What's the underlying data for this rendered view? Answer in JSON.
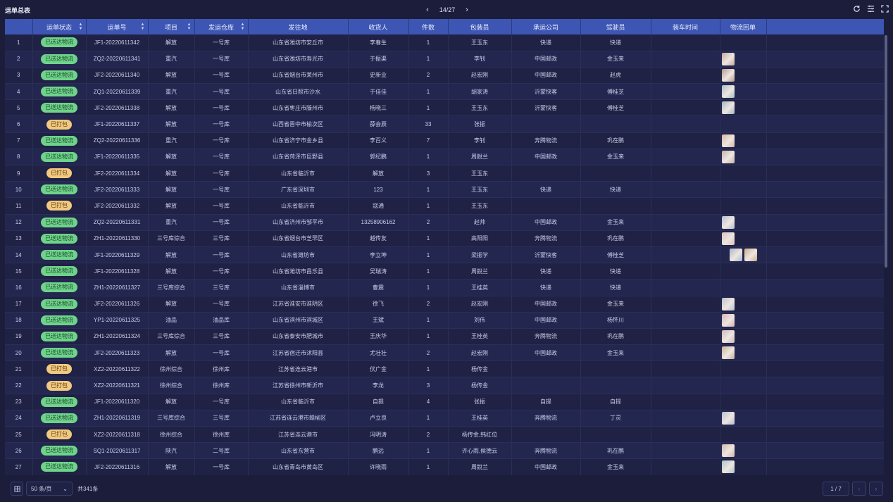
{
  "header": {
    "title": "运单总表",
    "page_indicator": "14/27",
    "prev_icon": "chevron-left-icon",
    "next_icon": "chevron-right-icon",
    "tools": [
      "refresh-icon",
      "column-settings-icon",
      "fullscreen-icon"
    ]
  },
  "table": {
    "columns": [
      "",
      "运单状态",
      "运单号",
      "项目",
      "发运仓库",
      "发往地",
      "收货人",
      "件数",
      "包装员",
      "承运公司",
      "驾驶员",
      "装车时间",
      "物流回单"
    ],
    "rows": [
      {
        "no": "1",
        "status": "已送达物流",
        "waybill": "JF1-20220611342",
        "project": "解放",
        "warehouse": "一号库",
        "dest": "山东省潍坊市安丘市",
        "consignee": "李春生",
        "qty": "1",
        "packer": "王玉东",
        "carrier": "快递",
        "driver": "快递",
        "time": "",
        "receipt": []
      },
      {
        "no": "2",
        "status": "已送达物流",
        "waybill": "ZQ2-20220611341",
        "project": "重汽",
        "warehouse": "一号库",
        "dest": "山东省潍坊市寿光市",
        "consignee": "于振渠",
        "qty": "1",
        "packer": "李钊",
        "carrier": "中国邮政",
        "driver": "金玉来",
        "time": "",
        "receipt": [
          "#c9a79a"
        ]
      },
      {
        "no": "3",
        "status": "已送达物流",
        "waybill": "JF2-20220611340",
        "project": "解放",
        "warehouse": "一号库",
        "dest": "山东省烟台市莱州市",
        "consignee": "史新业",
        "qty": "2",
        "packer": "赵宏刚",
        "carrier": "中国邮政",
        "driver": "赵虎",
        "time": "",
        "receipt": [
          "#b8998f"
        ]
      },
      {
        "no": "4",
        "status": "已送达物流",
        "waybill": "ZQ1-20220611339",
        "project": "重汽",
        "warehouse": "一号库",
        "dest": "山东省日照市沙水",
        "consignee": "于佳佳",
        "qty": "1",
        "packer": "胡家涛",
        "carrier": "沂蒙快客",
        "driver": "傅桂芝",
        "time": "",
        "receipt": [
          "#a9c0c6"
        ]
      },
      {
        "no": "5",
        "status": "已送达物流",
        "waybill": "JF2-20220611338",
        "project": "解放",
        "warehouse": "一号库",
        "dest": "山东省枣庄市滕州市",
        "consignee": "杨晓三",
        "qty": "1",
        "packer": "王玉东",
        "carrier": "沂蒙快客",
        "driver": "傅桂芝",
        "time": "",
        "receipt": [
          "#9fb7c4"
        ]
      },
      {
        "no": "6",
        "status": "已打包",
        "waybill": "JF1-20220611337",
        "project": "解放",
        "warehouse": "一号库",
        "dest": "山西省晋中市榆次区",
        "consignee": "薛会辰",
        "qty": "33",
        "packer": "张振",
        "carrier": "",
        "driver": "",
        "time": "",
        "receipt": []
      },
      {
        "no": "7",
        "status": "已送达物流",
        "waybill": "ZQ2-20220611336",
        "project": "重汽",
        "warehouse": "一号库",
        "dest": "山东省济宁市金乡县",
        "consignee": "李百义",
        "qty": "7",
        "packer": "李钊",
        "carrier": "奔腾物流",
        "driver": "巩在鹏",
        "time": "",
        "receipt": [
          "#d8b4a8"
        ]
      },
      {
        "no": "8",
        "status": "已送达物流",
        "waybill": "JF1-20220611335",
        "project": "解放",
        "warehouse": "一号库",
        "dest": "山东省菏泽市巨野县",
        "consignee": "郭纪鹏",
        "qty": "1",
        "packer": "周銳兰",
        "carrier": "中国邮政",
        "driver": "金玉来",
        "time": "",
        "receipt": [
          "#c4b4a8"
        ]
      },
      {
        "no": "9",
        "status": "已打包",
        "waybill": "JF2-20220611334",
        "project": "解放",
        "warehouse": "一号库",
        "dest": "山东省临沂市",
        "consignee": "解放",
        "qty": "3",
        "packer": "王玉东",
        "carrier": "",
        "driver": "",
        "time": "",
        "receipt": []
      },
      {
        "no": "10",
        "status": "已送达物流",
        "waybill": "JF2-20220611333",
        "project": "解放",
        "warehouse": "一号库",
        "dest": "广东省深圳市",
        "consignee": "123",
        "qty": "1",
        "packer": "王玉东",
        "carrier": "快递",
        "driver": "快递",
        "time": "",
        "receipt": []
      },
      {
        "no": "11",
        "status": "已打包",
        "waybill": "JF2-20220611332",
        "project": "解放",
        "warehouse": "一号库",
        "dest": "山东省临沂市",
        "consignee": "寇通",
        "qty": "1",
        "packer": "王玉东",
        "carrier": "",
        "driver": "",
        "time": "",
        "receipt": []
      },
      {
        "no": "12",
        "status": "已送达物流",
        "waybill": "ZQ2-20220611331",
        "project": "重汽",
        "warehouse": "一号库",
        "dest": "山东省济州市邹平市",
        "consignee": "13258906162",
        "qty": "2",
        "packer": "赵帅",
        "carrier": "中国邮政",
        "driver": "金玉来",
        "time": "",
        "receipt": [
          "#b3c2d3"
        ]
      },
      {
        "no": "13",
        "status": "已送达物流",
        "waybill": "ZH1-20220611330",
        "project": "三号库综合",
        "warehouse": "三号库",
        "dest": "山东省烟台市芝罘区",
        "consignee": "越传友",
        "qty": "1",
        "packer": "高阳阳",
        "carrier": "奔腾物流",
        "driver": "巩在鹏",
        "time": "",
        "receipt": [
          "#e0c0c0"
        ]
      },
      {
        "no": "14",
        "status": "已送达物流",
        "waybill": "JF1-20220611329",
        "project": "解放",
        "warehouse": "一号库",
        "dest": "山东省潍坊市",
        "consignee": "李立坤",
        "qty": "1",
        "packer": "梁振学",
        "carrier": "沂蒙快客",
        "driver": "傅桂芝",
        "time": "",
        "receipt": [
          "#a8b8c8",
          "#c8b08a"
        ],
        "indent": true
      },
      {
        "no": "15",
        "status": "已送达物流",
        "waybill": "JF1-20220611328",
        "project": "解放",
        "warehouse": "一号库",
        "dest": "山东省潍坊市昌乐县",
        "consignee": "吴瑞涛",
        "qty": "1",
        "packer": "周銳兰",
        "carrier": "快递",
        "driver": "快递",
        "time": "",
        "receipt": []
      },
      {
        "no": "16",
        "status": "已送达物流",
        "waybill": "ZH1-20220611327",
        "project": "三号库综合",
        "warehouse": "三号库",
        "dest": "山东省淄博市",
        "consignee": "曹震",
        "qty": "1",
        "packer": "王桂英",
        "carrier": "快递",
        "driver": "快递",
        "time": "",
        "receipt": []
      },
      {
        "no": "17",
        "status": "已送达物流",
        "waybill": "JF2-20220611326",
        "project": "解放",
        "warehouse": "一号库",
        "dest": "江苏省淮安市淮阴区",
        "consignee": "徐飞",
        "qty": "2",
        "packer": "赵宏刚",
        "carrier": "中国邮政",
        "driver": "金玉来",
        "time": "",
        "receipt": [
          "#b9c3d0"
        ]
      },
      {
        "no": "18",
        "status": "已送达物流",
        "waybill": "YP1-20220611325",
        "project": "油品",
        "warehouse": "油品库",
        "dest": "山东省滨州市滨城区",
        "consignee": "王斌",
        "qty": "1",
        "packer": "刘伟",
        "carrier": "中国邮政",
        "driver": "杨怀川",
        "time": "",
        "receipt": [
          "#d8b0b8"
        ]
      },
      {
        "no": "19",
        "status": "已送达物流",
        "waybill": "ZH1-20220611324",
        "project": "三号库综合",
        "warehouse": "三号库",
        "dest": "山东省泰安市肥城市",
        "consignee": "王庆华",
        "qty": "1",
        "packer": "王桂英",
        "carrier": "奔腾物流",
        "driver": "巩在鹏",
        "time": "",
        "receipt": [
          "#d0b8c0"
        ]
      },
      {
        "no": "20",
        "status": "已送达物流",
        "waybill": "JF2-20220611323",
        "project": "解放",
        "warehouse": "一号库",
        "dest": "江苏省宿迁市沭阳县",
        "consignee": "尤壮壮",
        "qty": "2",
        "packer": "赵宏刚",
        "carrier": "中国邮政",
        "driver": "金玉来",
        "time": "",
        "receipt": [
          "#c8b098"
        ]
      },
      {
        "no": "21",
        "status": "已打包",
        "waybill": "XZ2-20220611322",
        "project": "徐州综合",
        "warehouse": "徐州库",
        "dest": "江苏省连云港市",
        "consignee": "伏广金",
        "qty": "1",
        "packer": "杨传金",
        "carrier": "",
        "driver": "",
        "time": "",
        "receipt": []
      },
      {
        "no": "22",
        "status": "已打包",
        "waybill": "XZ2-20220611321",
        "project": "徐州综合",
        "warehouse": "徐州库",
        "dest": "江苏省徐州市新沂市",
        "consignee": "李龙",
        "qty": "3",
        "packer": "杨传金",
        "carrier": "",
        "driver": "",
        "time": "",
        "receipt": []
      },
      {
        "no": "23",
        "status": "已送达物流",
        "waybill": "JF1-20220611320",
        "project": "解放",
        "warehouse": "一号库",
        "dest": "山东省临沂市",
        "consignee": "自提",
        "qty": "4",
        "packer": "张振",
        "carrier": "自提",
        "driver": "自提",
        "time": "",
        "receipt": []
      },
      {
        "no": "24",
        "status": "已送达物流",
        "waybill": "ZH1-20220611319",
        "project": "三号库综合",
        "warehouse": "三号库",
        "dest": "江苏省连云港市赣榆区",
        "consignee": "卢立良",
        "qty": "1",
        "packer": "王桂英",
        "carrier": "奔腾物流",
        "driver": "丁灵",
        "time": "",
        "receipt": [
          "#b8bfd0"
        ]
      },
      {
        "no": "25",
        "status": "已打包",
        "waybill": "XZ2-20220611318",
        "project": "徐州综合",
        "warehouse": "徐州库",
        "dest": "江苏省连云港市",
        "consignee": "冯明涛",
        "qty": "2",
        "packer": "杨传金,韩红位",
        "carrier": "",
        "driver": "",
        "time": "",
        "receipt": []
      },
      {
        "no": "26",
        "status": "已送达物流",
        "waybill": "SQ1-20220611317",
        "project": "陕汽",
        "warehouse": "二号库",
        "dest": "山东省东营市",
        "consignee": "鹏远",
        "qty": "1",
        "packer": "许心雨,侯德云",
        "carrier": "奔腾物流",
        "driver": "巩在鹏",
        "time": "",
        "receipt": [
          "#d0b8a8"
        ]
      },
      {
        "no": "27",
        "status": "已送达物流",
        "waybill": "JF2-20220611316",
        "project": "解放",
        "warehouse": "一号库",
        "dest": "山东省青岛市黄岛区",
        "consignee": "许晓雨",
        "qty": "1",
        "packer": "周銳兰",
        "carrier": "中国邮政",
        "driver": "金玉来",
        "time": "",
        "receipt": [
          "#a8c8c8"
        ]
      }
    ]
  },
  "footer": {
    "page_size": "50 条/页",
    "total": "共341条",
    "current_page": "1",
    "page_total": "/ 7"
  },
  "colors": {
    "accent": "#3d56b3",
    "delivered": "#6fd38b",
    "packed": "#f2c980",
    "background": "#1b1d3a"
  }
}
